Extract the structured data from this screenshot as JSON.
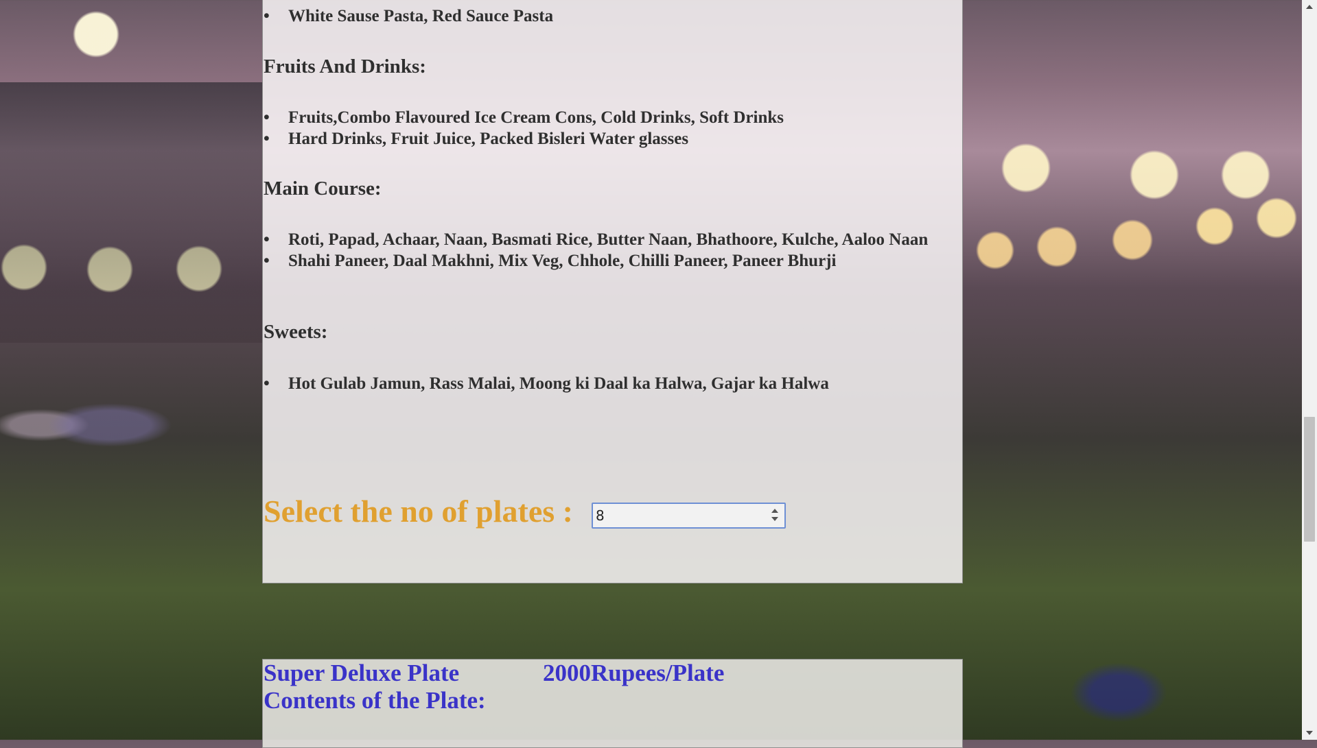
{
  "menu": {
    "pasta_item": "White Sause Pasta, Red Sauce Pasta",
    "fruits_title": "Fruits And Drinks:",
    "fruits_items": [
      "Fruits,Combo Flavoured Ice Cream Cons, Cold Drinks, Soft Drinks",
      "Hard Drinks, Fruit Juice, Packed Bisleri Water glasses"
    ],
    "main_title": "Main Course:",
    "main_items": [
      "Roti, Papad, Achaar, Naan, Basmati Rice, Butter Naan, Bhathoore, Kulche, Aaloo Naan",
      "Shahi Paneer, Daal Makhni, Mix Veg, Chhole, Chilli Paneer, Paneer Bhurji"
    ],
    "sweets_title": "Sweets:",
    "sweets_items": [
      "Hot Gulab Jamun, Rass Malai, Moong ki Daal ka Halwa, Gajar ka Halwa"
    ]
  },
  "plates": {
    "label": "Select the no of plates :",
    "value": "8"
  },
  "next_plan": {
    "name": "Super Deluxe Plate",
    "price": "2000Rupees/Plate",
    "contents_label": "Contents of the Plate:"
  },
  "colors": {
    "plates_label": "#e0a030",
    "plan_title": "#3a33c8"
  },
  "icons": {
    "spin": "spinner-arrows-icon",
    "scroll_up": "scroll-up-arrow-icon",
    "scroll_down": "scroll-down-arrow-icon"
  }
}
